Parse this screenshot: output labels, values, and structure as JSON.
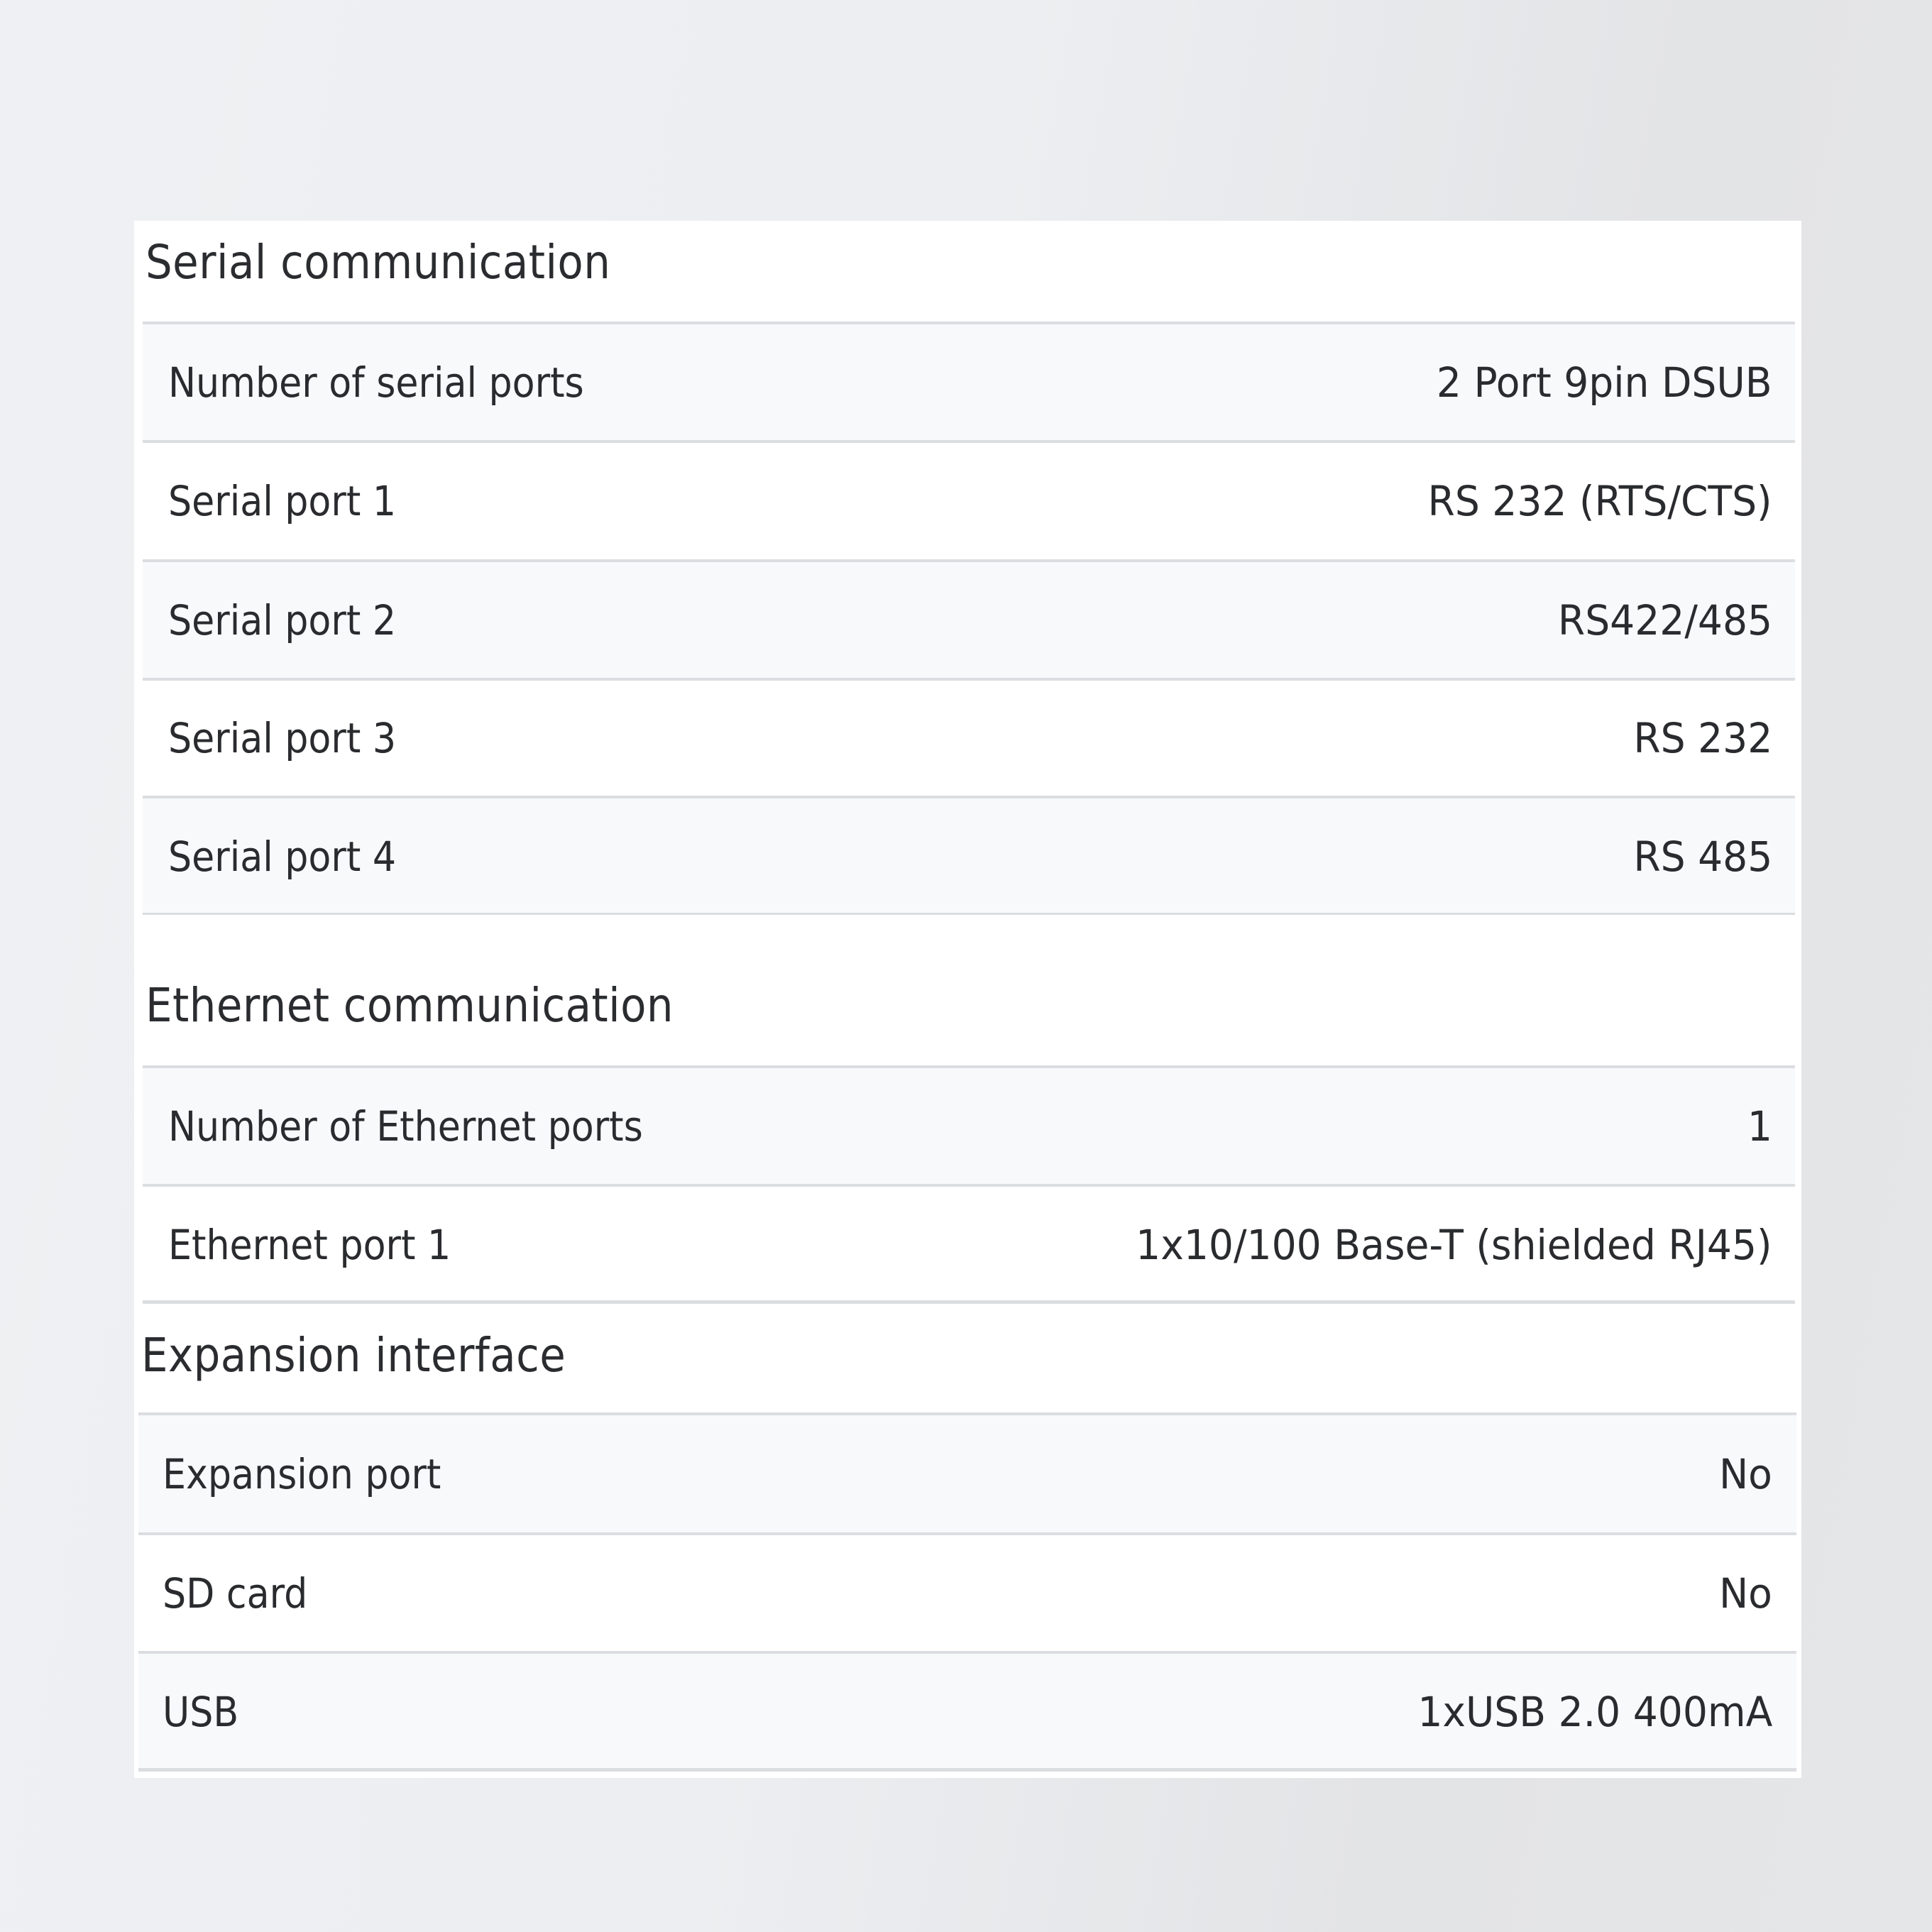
{
  "sections": [
    {
      "title": "Serial communication",
      "rows": [
        {
          "label": "Number of serial ports",
          "value": "2 Port 9pin DSUB"
        },
        {
          "label": "Serial port 1",
          "value": "RS 232 (RTS/CTS)"
        },
        {
          "label": "Serial port 2",
          "value": "RS422/485"
        },
        {
          "label": "Serial port 3",
          "value": "RS 232"
        },
        {
          "label": "Serial port 4",
          "value": "RS 485"
        }
      ]
    },
    {
      "title": "Ethernet communication",
      "rows": [
        {
          "label": "Number of Ethernet ports",
          "value": "1"
        },
        {
          "label": "Ethernet port 1",
          "value": "1x10/100 Base-T (shielded RJ45)"
        }
      ]
    },
    {
      "title": "Expansion interface",
      "rows": [
        {
          "label": "Expansion port",
          "value": "No"
        },
        {
          "label": "SD card",
          "value": "No"
        },
        {
          "label": "USB",
          "value": "1xUSB 2.0 400mA"
        }
      ]
    }
  ]
}
